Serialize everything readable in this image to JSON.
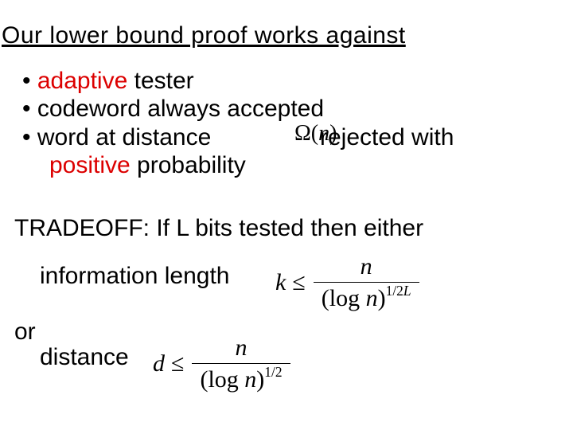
{
  "heading": "Our lower bound proof works against",
  "bullets": {
    "b1_pre": "• ",
    "b1_red": "adaptive",
    "b1_post": " tester",
    "b2": "• codeword always accepted",
    "b3_pre": "• word at distance",
    "b3_post": "rejected with",
    "b4_red": "positive",
    "b4_post": " probability"
  },
  "omega": {
    "open": "Ω(",
    "var": "n",
    "close": ")"
  },
  "tradeoff": "TRADEOFF: If L bits tested then either",
  "info_label": "information length",
  "or_label": "or",
  "dist_label": "distance",
  "formula_k": {
    "lead": "k",
    "leq": "≤",
    "num": "n",
    "den_open": "(log ",
    "den_var": "n",
    "den_close": ")",
    "den_exp_a": "1/2",
    "den_exp_b": "L"
  },
  "formula_d": {
    "lead": "d",
    "leq": "≤",
    "num": "n",
    "den_open": "(log ",
    "den_var": "n",
    "den_close": ")",
    "den_exp": "1/2"
  }
}
